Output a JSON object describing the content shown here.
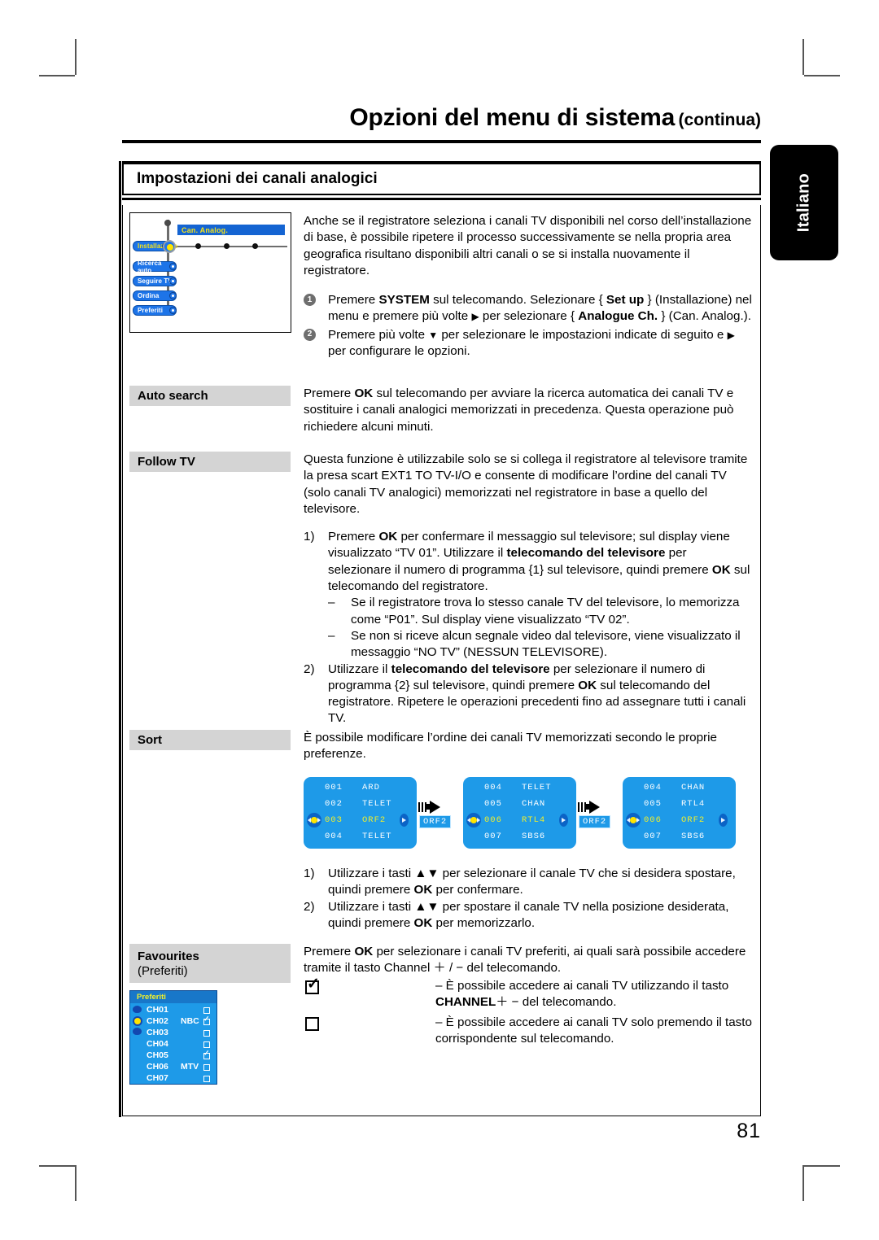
{
  "header": {
    "title_main": "Opzioni del menu di sistema",
    "title_continued": "(continua)",
    "subtitle": "Impostazioni dei canali analogici",
    "language_tab": "Italiano"
  },
  "osd_tree": {
    "header_label": "Can. Analog.",
    "items": [
      {
        "label": "Installazione",
        "selected": true
      },
      {
        "label": "Ricerca auto",
        "selected": false
      },
      {
        "label": "Seguire TV",
        "selected": false
      },
      {
        "label": "Ordina",
        "selected": false
      },
      {
        "label": "Preferiti",
        "selected": false
      }
    ]
  },
  "intro": {
    "paragraph": "Anche se il registratore seleziona i canali TV disponibili nel corso dell’installazione di base, è possibile ripetere il processo successivamente se nella propria area geografica risultano disponibili altri canali o se si installa nuovamente il registratore.",
    "steps": [
      {
        "badge": "1",
        "pre": "Premere ",
        "key1": "SYSTEM",
        "mid1": " sul telecomando. Selezionare { ",
        "key2": "Set up",
        "mid2": " } (Installazione) nel menu e premere più volte ",
        "arrow": "▶",
        "mid3": " per selezionare { ",
        "key3": "Analogue Ch.",
        "post": " } (Can. Analog.)."
      },
      {
        "badge": "2",
        "pre": "Premere più volte ",
        "arrow_down": "▼",
        "mid1": " per selezionare le impostazioni indicate di seguito e ",
        "arrow_right": "▶",
        "post": " per configurare le opzioni."
      }
    ]
  },
  "sections": {
    "auto_search": {
      "label": "Auto search",
      "pre": "Premere ",
      "key": "OK",
      "post": " sul telecomando per avviare la ricerca automatica dei canali TV e sostituire i canali analogici memorizzati in precedenza. Questa operazione può richiedere alcuni minuti."
    },
    "follow_tv": {
      "label": "Follow TV",
      "intro": "Questa funzione è utilizzabile solo se si collega il registratore al televisore tramite la presa scart EXT1 TO TV-I/O e consente di modificare l’ordine del canali TV (solo canali TV analogici) memorizzati nel registratore in base a quello del televisore.",
      "step1": {
        "num": "1)",
        "a": "Premere ",
        "k1": "OK",
        "b": " per confermare il messaggio sul televisore; sul display viene visualizzato “TV 01”. Utilizzare il ",
        "k2": "telecomando del televisore",
        "c": " per selezionare il numero di programma {1} sul televisore, quindi premere ",
        "k3": "OK",
        "d": " sul telecomando del registratore."
      },
      "bullets": [
        "Se il registratore trova lo stesso canale TV del televisore, lo memorizza come “P01”. Sul display viene visualizzato “TV 02”.",
        "Se non si riceve alcun segnale video dal televisore, viene visualizzato il messaggio “NO TV” (NESSUN TELEVISORE)."
      ],
      "step2": {
        "num": "2)",
        "a": "Utilizzare il ",
        "k1": "telecomando del televisore",
        "b": " per selezionare il numero di programma {2} sul televisore, quindi premere ",
        "k2": "OK",
        "c": " sul telecomando del registratore.  Ripetere le operazioni precedenti fino ad assegnare tutti i canali TV."
      }
    },
    "sort": {
      "label": "Sort",
      "intro": "È possibile modificare l’ordine dei canali TV memorizzati secondo le proprie preferenze.",
      "screens": [
        {
          "rows": [
            {
              "num": "001",
              "name": "ARD",
              "highlight": false
            },
            {
              "num": "002",
              "name": "TELET",
              "highlight": false
            },
            {
              "num": "003",
              "name": "ORF2",
              "highlight": true
            },
            {
              "num": "004",
              "name": "TELET",
              "highlight": false
            }
          ],
          "tag": "ORF2"
        },
        {
          "rows": [
            {
              "num": "004",
              "name": "TELET",
              "highlight": false
            },
            {
              "num": "005",
              "name": "CHAN",
              "highlight": false
            },
            {
              "num": "006",
              "name": "RTL4",
              "highlight": true
            },
            {
              "num": "007",
              "name": "SBS6",
              "highlight": false
            }
          ],
          "tag": "ORF2"
        },
        {
          "rows": [
            {
              "num": "004",
              "name": "CHAN",
              "highlight": false
            },
            {
              "num": "005",
              "name": "RTL4",
              "highlight": false
            },
            {
              "num": "006",
              "name": "ORF2",
              "highlight": true
            },
            {
              "num": "007",
              "name": "SBS6",
              "highlight": false
            }
          ],
          "tag": ""
        }
      ],
      "step1": {
        "num": "1)",
        "a": "Utilizzare i tasti ",
        "arrows": "▲▼",
        "b": " per selezionare il canale TV che si desidera spostare, quindi premere ",
        "k": "OK",
        "c": " per confermare."
      },
      "step2": {
        "num": "2)",
        "a": "Utilizzare i tasti ",
        "arrows": "▲▼",
        "b": " per spostare il canale TV nella posizione desiderata, quindi premere ",
        "k": "OK",
        "c": " per memorizzarlo."
      }
    },
    "favourites": {
      "label": "Favourites",
      "label_sub": "(Preferiti)",
      "intro_a": "Premere ",
      "intro_k": "OK",
      "intro_b": " per selezionare i canali TV preferiti, ai quali sarà possibile accedere tramite il tasto Channel ",
      "intro_pm": "＋ / −",
      "intro_c": " del telecomando.",
      "checked_note_a": "– È possibile accedere ai canali TV utilizzando il tasto ",
      "checked_note_k": "CHANNEL",
      "checked_note_pm": "＋ −",
      "checked_note_b": " del telecomando.",
      "unchecked_note": "– È possibile accedere ai canali TV solo premendo il tasto corrispondente sul telecomando.",
      "osd": {
        "header": "Preferiti",
        "rows": [
          {
            "ch": "CH01",
            "net": "",
            "checked": false,
            "cursor": false
          },
          {
            "ch": "CH02",
            "net": "NBC",
            "checked": true,
            "cursor": true
          },
          {
            "ch": "CH03",
            "net": "",
            "checked": false,
            "cursor": false
          },
          {
            "ch": "CH04",
            "net": "",
            "checked": false,
            "cursor": false
          },
          {
            "ch": "CH05",
            "net": "",
            "checked": true,
            "cursor": false
          },
          {
            "ch": "CH06",
            "net": "MTV",
            "checked": false,
            "cursor": false
          },
          {
            "ch": "CH07",
            "net": "",
            "checked": false,
            "cursor": false
          }
        ]
      }
    }
  },
  "footer": {
    "page_number": "81"
  },
  "colors": {
    "osd_blue": "#1e9ae8",
    "osd_yellow": "#f2ef2a",
    "label_gray": "#d4d4d4"
  }
}
